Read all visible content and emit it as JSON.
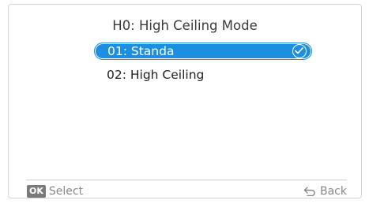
{
  "screen": {
    "title": "H0: High Ceiling Mode",
    "options": [
      {
        "label": "01: Standa",
        "selected": true,
        "icon": "check-circle-icon"
      },
      {
        "label": "02: High Ceiling",
        "selected": false
      }
    ]
  },
  "footer": {
    "ok_badge": "OK",
    "select_label": "Select",
    "back_label": "Back",
    "back_icon": "back-arrow-icon"
  },
  "colors": {
    "accent": "#1d8fe1",
    "text": "#3a3a3a",
    "muted": "#888888"
  }
}
